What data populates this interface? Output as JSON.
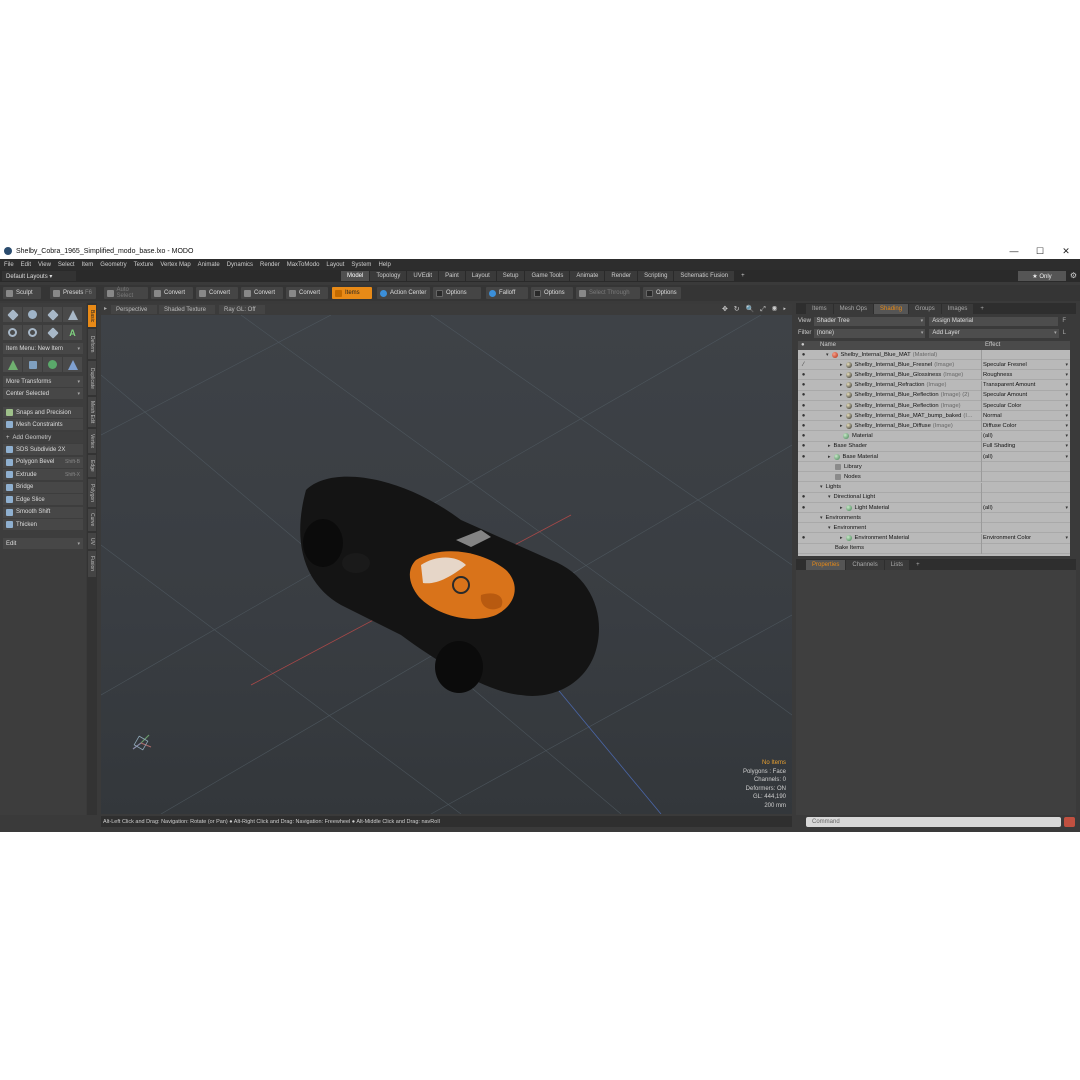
{
  "window": {
    "title": "Shelby_Cobra_1965_Simplified_modo_base.lxo - MODO",
    "minimize": "—",
    "maximize": "☐",
    "close": "✕"
  },
  "menu": [
    "File",
    "Edit",
    "View",
    "Select",
    "Item",
    "Geometry",
    "Texture",
    "Vertex Map",
    "Animate",
    "Dynamics",
    "Render",
    "MaxToModo",
    "Layout",
    "System",
    "Help"
  ],
  "layout": {
    "selector": "Default Layouts ▾",
    "tabs": [
      "Model",
      "Topology",
      "UVEdit",
      "Paint",
      "Layout",
      "Setup",
      "Game Tools",
      "Animate",
      "Render",
      "Scripting",
      "Schematic Fusion"
    ],
    "active_tab": "Model",
    "add": "+",
    "only": "★ Only"
  },
  "toolbar": {
    "sculpt": "Sculpt",
    "presets": "Presets",
    "presets_key": "F6",
    "auto_select": "Auto Select",
    "convert": "Convert",
    "items": "Items",
    "action_center": "Action Center",
    "options": "Options",
    "falloff": "Falloff",
    "select_through": "Select Through"
  },
  "left": {
    "item_menu": "Item Menu: New Item",
    "more_transforms": "More Transforms",
    "center_selected": "Center Selected",
    "snaps": "Snaps and Precision",
    "mesh_constraints": "Mesh Constraints",
    "add_geometry": "Add Geometry",
    "tools": [
      {
        "label": "SDS Subdivide 2X",
        "key": ""
      },
      {
        "label": "Polygon Bevel",
        "key": "Shift-B"
      },
      {
        "label": "Extrude",
        "key": "Shift-X"
      },
      {
        "label": "Bridge",
        "key": ""
      },
      {
        "label": "Edge Slice",
        "key": ""
      },
      {
        "label": "Smooth Shift",
        "key": ""
      },
      {
        "label": "Thicken",
        "key": ""
      }
    ],
    "edit": "Edit",
    "vtabs": [
      "Basic",
      "Deform",
      "Duplicate",
      "Mesh Edit",
      "Vertex",
      "Edge",
      "Polygon",
      "Curve",
      "UV",
      "Fusion"
    ]
  },
  "viewport": {
    "perspective": "Perspective",
    "shading": "Shaded Texture",
    "raygl": "Ray GL: Off",
    "nav_icons": "✥ ↻ 🔍 ⤢ ◉ ▸",
    "info": {
      "no_items": "No Items",
      "polygons": "Polygons : Face",
      "channels": "Channels: 0",
      "deformers": "Deformers: ON",
      "gl": "GL: 444,190",
      "scale": "200 mm"
    }
  },
  "status": "Alt-Left Click and Drag: Navigation: Rotate (or Pan) ● Alt-Right Click and Drag: Navigation: Freewheel ● Alt-Middle Click and Drag: navRoll",
  "right": {
    "tabs": [
      "Items",
      "Mesh Ops",
      "Shading",
      "Groups",
      "Images"
    ],
    "active_tab": "Shading",
    "add": "+",
    "view_label": "View",
    "view_value": "Shader Tree",
    "assign": "Assign Material",
    "assign_key": "F",
    "filter_label": "Filter",
    "filter_value": "(none)",
    "add_layer": "Add Layer",
    "add_layer_key": "L",
    "col_name": "Name",
    "col_effect": "Effect",
    "rows": [
      {
        "eye": "●",
        "indent": 14,
        "tw": "▾",
        "ball": "red",
        "name": "Shelby_Internal_Blue_MAT",
        "sub": "(Material)",
        "effect": "",
        "arr": ""
      },
      {
        "eye": "⁄",
        "indent": 28,
        "tw": "▸",
        "ball": "img",
        "name": "Shelby_Internal_Blue_Fresnel",
        "sub": "(Image)",
        "effect": "Specular Fresnel",
        "arr": "▾"
      },
      {
        "eye": "●",
        "indent": 28,
        "tw": "▸",
        "ball": "img",
        "name": "Shelby_Internal_Blue_Glossiness",
        "sub": "(Image)",
        "effect": "Roughness",
        "arr": "▾"
      },
      {
        "eye": "●",
        "indent": 28,
        "tw": "▸",
        "ball": "img",
        "name": "Shelby_Internal_Refraction",
        "sub": "(Image)",
        "effect": "Transparent Amount",
        "arr": "▾"
      },
      {
        "eye": "●",
        "indent": 28,
        "tw": "▸",
        "ball": "img",
        "name": "Shelby_Internal_Blue_Reflection",
        "sub": "(Image) (2)",
        "effect": "Specular Amount",
        "arr": "▾"
      },
      {
        "eye": "●",
        "indent": 28,
        "tw": "▸",
        "ball": "img",
        "name": "Shelby_Internal_Blue_Reflection",
        "sub": "(Image)",
        "effect": "Specular Color",
        "arr": "▾"
      },
      {
        "eye": "●",
        "indent": 28,
        "tw": "▸",
        "ball": "img",
        "name": "Shelby_Internal_Blue_MAT_bump_baked",
        "sub": "(I…",
        "effect": "Normal",
        "arr": "▾"
      },
      {
        "eye": "●",
        "indent": 28,
        "tw": "▸",
        "ball": "img",
        "name": "Shelby_Internal_Blue_Diffuse",
        "sub": "(Image)",
        "effect": "Diffuse Color",
        "arr": "▾"
      },
      {
        "eye": "●",
        "indent": 28,
        "tw": "",
        "ball": "grn",
        "name": "Material",
        "sub": "",
        "effect": "(all)",
        "arr": "▾"
      },
      {
        "eye": "●",
        "indent": 16,
        "tw": "▸",
        "ball": "",
        "name": "Base Shader",
        "sub": "",
        "effect": "Full Shading",
        "arr": "▾"
      },
      {
        "eye": "●",
        "indent": 16,
        "tw": "▸",
        "ball": "grn",
        "name": "Base Material",
        "sub": "",
        "effect": "(all)",
        "arr": "▾"
      },
      {
        "eye": "",
        "indent": 20,
        "tw": "",
        "ball": "lib",
        "name": "Library",
        "sub": "",
        "effect": "",
        "arr": ""
      },
      {
        "eye": "",
        "indent": 20,
        "tw": "",
        "ball": "lib",
        "name": "Nodes",
        "sub": "",
        "effect": "",
        "arr": ""
      },
      {
        "eye": "",
        "indent": 8,
        "tw": "▾",
        "ball": "",
        "name": "Lights",
        "sub": "",
        "effect": "",
        "arr": ""
      },
      {
        "eye": "●",
        "indent": 16,
        "tw": "▾",
        "ball": "",
        "name": "Directional Light",
        "sub": "",
        "effect": "",
        "arr": ""
      },
      {
        "eye": "●",
        "indent": 28,
        "tw": "▸",
        "ball": "grn",
        "name": "Light Material",
        "sub": "",
        "effect": "(all)",
        "arr": "▾"
      },
      {
        "eye": "",
        "indent": 8,
        "tw": "▾",
        "ball": "",
        "name": "Environments",
        "sub": "",
        "effect": "",
        "arr": ""
      },
      {
        "eye": "",
        "indent": 16,
        "tw": "▾",
        "ball": "",
        "name": "Environment",
        "sub": "",
        "effect": "",
        "arr": ""
      },
      {
        "eye": "●",
        "indent": 28,
        "tw": "▸",
        "ball": "grn",
        "name": "Environment Material",
        "sub": "",
        "effect": "Environment Color",
        "arr": "▾"
      },
      {
        "eye": "",
        "indent": 20,
        "tw": "",
        "ball": "",
        "name": "Bake Items",
        "sub": "",
        "effect": "",
        "arr": ""
      }
    ],
    "prop_tabs": [
      "Properties",
      "Channels",
      "Lists"
    ],
    "prop_active": "Properties",
    "command_placeholder": "Command"
  }
}
